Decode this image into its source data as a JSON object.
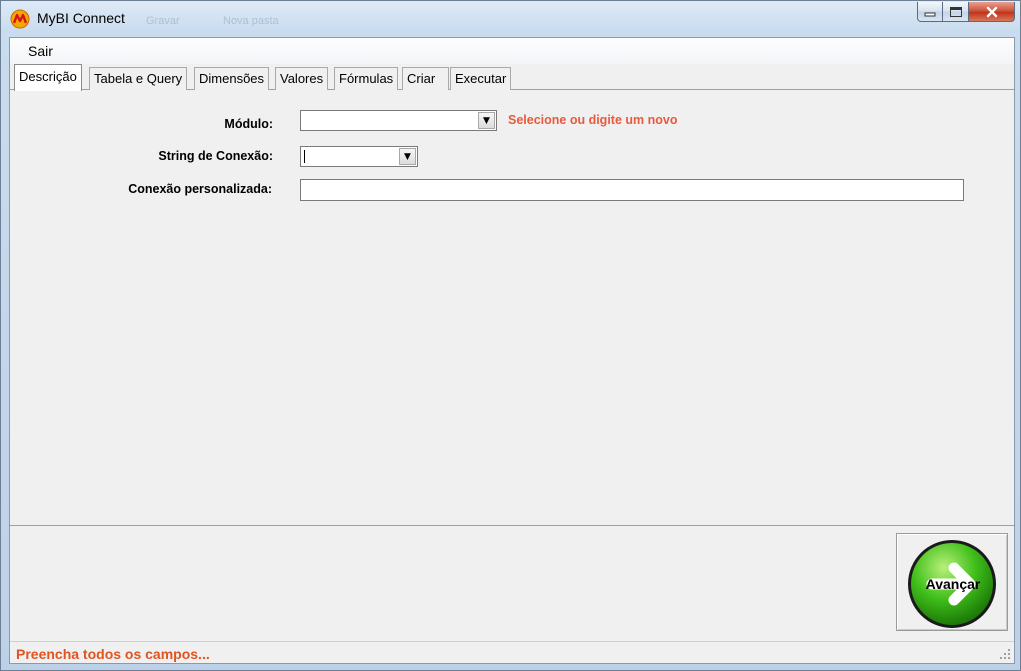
{
  "window": {
    "title": "MyBI Connect",
    "ghost_texts": [
      "Gravar",
      "Nova pasta"
    ],
    "app_icon": "mybi-logo-icon"
  },
  "menu": {
    "items": [
      {
        "label": "Sair"
      }
    ]
  },
  "tabs": [
    {
      "label": "Descrição",
      "active": true
    },
    {
      "label": "Tabela e Query",
      "active": false
    },
    {
      "label": "Dimensões",
      "active": false
    },
    {
      "label": "Valores",
      "active": false
    },
    {
      "label": "Fórmulas",
      "active": false
    },
    {
      "label": "Criar",
      "active": false
    },
    {
      "label": "Executar",
      "active": false
    }
  ],
  "form": {
    "modulo_label": "Módulo:",
    "modulo_value": "",
    "modulo_hint": "Selecione ou digite um novo",
    "string_label": "String de Conexão:",
    "string_value": "",
    "custom_label": "Conexão personalizada:",
    "custom_value": ""
  },
  "next_button": {
    "label": "Avançar",
    "icon": "green-arrow-right-icon"
  },
  "status": {
    "message": "Preencha todos os campos..."
  },
  "colors": {
    "hint": "#e85a3c",
    "status": "#e2541f",
    "next_green": "#3fbf1a"
  }
}
